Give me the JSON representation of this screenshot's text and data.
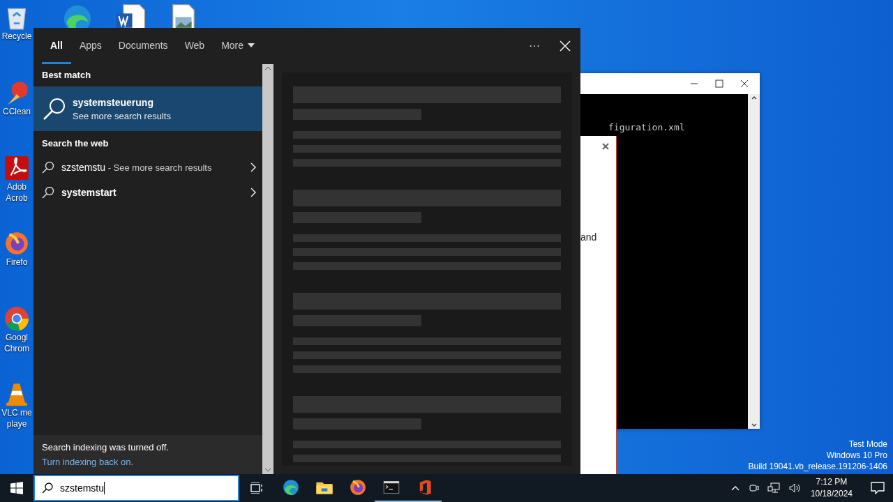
{
  "desktop_icons": [
    {
      "kind": "recycle",
      "lines": [
        "Recycle"
      ]
    },
    {
      "kind": "ccleaner",
      "lines": [
        "CClean"
      ]
    },
    {
      "kind": "acrobat",
      "lines": [
        "Adob",
        "Acrob"
      ]
    },
    {
      "kind": "firefox",
      "lines": [
        "Firefo"
      ]
    },
    {
      "kind": "chrome",
      "lines": [
        "Googl",
        "Chrom"
      ]
    },
    {
      "kind": "vlc",
      "lines": [
        "VLC me",
        "playe"
      ]
    }
  ],
  "top_icons": [
    {
      "kind": "edge"
    },
    {
      "kind": "word"
    },
    {
      "kind": "image"
    }
  ],
  "console_window": {
    "text": "figuration.xml"
  },
  "dialog": {
    "text": "and"
  },
  "search": {
    "tabs": [
      {
        "label": "All",
        "selected": true
      },
      {
        "label": "Apps",
        "selected": false
      },
      {
        "label": "Documents",
        "selected": false
      },
      {
        "label": "Web",
        "selected": false
      },
      {
        "label": "More",
        "selected": false
      }
    ],
    "more_menu": "···",
    "best_match_heading": "Best match",
    "best_match": {
      "title": "systemsteuerung",
      "subtitle": "See more search results",
      "selected": true
    },
    "web_heading": "Search the web",
    "web_results": [
      {
        "query": "szstemstu",
        "hint": "- See more search results",
        "bold": false
      },
      {
        "query": "systemstart",
        "bold": true
      }
    ],
    "footer": {
      "message": "Search indexing was turned off.",
      "link": "Turn indexing back on."
    }
  },
  "taskbar": {
    "query": "szstemstu",
    "apps": [
      {
        "kind": "edge",
        "running": false
      },
      {
        "kind": "explorer",
        "running": false
      },
      {
        "kind": "firefox",
        "running": false
      },
      {
        "kind": "cmd",
        "running": true
      },
      {
        "kind": "office",
        "running": true
      }
    ],
    "time": "7:12 PM",
    "date": "10/18/2024"
  },
  "system_notice": [
    "Test Mode",
    "Windows 10 Pro",
    "Build 19041.vb_release.191206-1406"
  ]
}
